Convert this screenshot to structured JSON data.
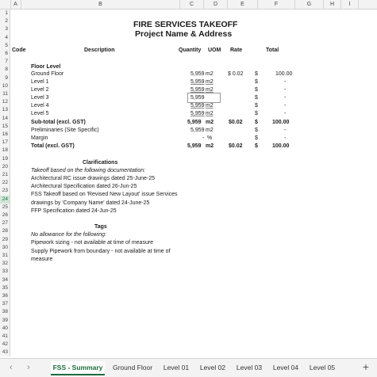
{
  "columns": [
    "A",
    "B",
    "C",
    "D",
    "E",
    "F",
    "G",
    "H",
    "I"
  ],
  "rows": [
    "1",
    "2",
    "3",
    "4",
    "5",
    "6",
    "7",
    "8",
    "9",
    "10",
    "11",
    "12",
    "13",
    "14",
    "15",
    "16",
    "17",
    "18",
    "19",
    "20",
    "21",
    "22",
    "23",
    "24",
    "25",
    "26",
    "27",
    "28",
    "29",
    "30",
    "31",
    "32",
    "33",
    "34",
    "35",
    "36",
    "37",
    "38",
    "39",
    "40",
    "41",
    "42",
    "43",
    "44"
  ],
  "selected_row": "24",
  "title": "FIRE SERVICES TAKEOFF",
  "subtitle": "Project Name & Address",
  "headers": {
    "code": "Code",
    "description": "Description",
    "quantity": "Quantity",
    "uom": "UOM",
    "rate": "Rate",
    "total": "Total"
  },
  "floor_level": "Floor Level",
  "lines": [
    {
      "desc": "Ground Floor",
      "qty": "5,959",
      "uom": "m2",
      "rate": "$ 0.02",
      "cur": "$",
      "total": "100.00"
    },
    {
      "desc": "Level 1",
      "qty": "5,959",
      "uom": "m2",
      "rate": "",
      "cur": "$",
      "total": "-"
    },
    {
      "desc": "Level 2",
      "qty": "5,959",
      "uom": "m2",
      "rate": "",
      "cur": "$",
      "total": "-"
    },
    {
      "desc": "Level 3",
      "qty": "5,959",
      "uom": "",
      "rate": "",
      "cur": "$",
      "total": "-"
    },
    {
      "desc": "Level 4",
      "qty": "5,959",
      "uom": "m2",
      "rate": "",
      "cur": "$",
      "total": "-"
    },
    {
      "desc": "Level 5",
      "qty": "5,959",
      "uom": "m2",
      "rate": "",
      "cur": "$",
      "total": "-"
    }
  ],
  "subtotal": {
    "label": "Sub-total (excl. GST)",
    "qty": "5,959",
    "uom": "m2",
    "rate": "$0.02",
    "cur": "$",
    "total": "100.00"
  },
  "prelims": {
    "label": "Preliminaries (Site Specific)",
    "qty": "5,959",
    "uom": "m2",
    "cur": "$",
    "total": "-"
  },
  "margin": {
    "label": "Margin",
    "qty": "-",
    "uom": "%",
    "cur": "$",
    "total": "-"
  },
  "total": {
    "label": "Total (excl. GST)",
    "qty": "5,959",
    "uom": "m2",
    "rate": "$0.02",
    "cur": "$",
    "total": "100.00"
  },
  "clarifications": {
    "heading": "Clarifications",
    "intro": "Takeoff based on the following documentation:",
    "items": [
      "Architectural RC issue drawings dated 25-June-25",
      "Architectural Specification dated 26-Jun-25",
      "FSS Takeoff based on 'Revised New Layout' issue Services",
      "drawings by 'Company Name' dated 24-June-25",
      "FFP Specification dated 24-Jun-25"
    ]
  },
  "tags": {
    "heading": "Tags",
    "intro": "No allowance for the following:",
    "items": [
      "Pipework sizing - not available at time of measure",
      "Supply Pipework from boundary - not available at time of",
      "measure"
    ]
  },
  "tabs": [
    "FSS - Summary",
    "Ground Floor",
    "Level 01",
    "Level 02",
    "Level 03",
    "Level 04",
    "Level 05"
  ],
  "active_tab": "FSS - Summary",
  "nav": {
    "prev": "‹",
    "next": "›",
    "add": "+"
  }
}
